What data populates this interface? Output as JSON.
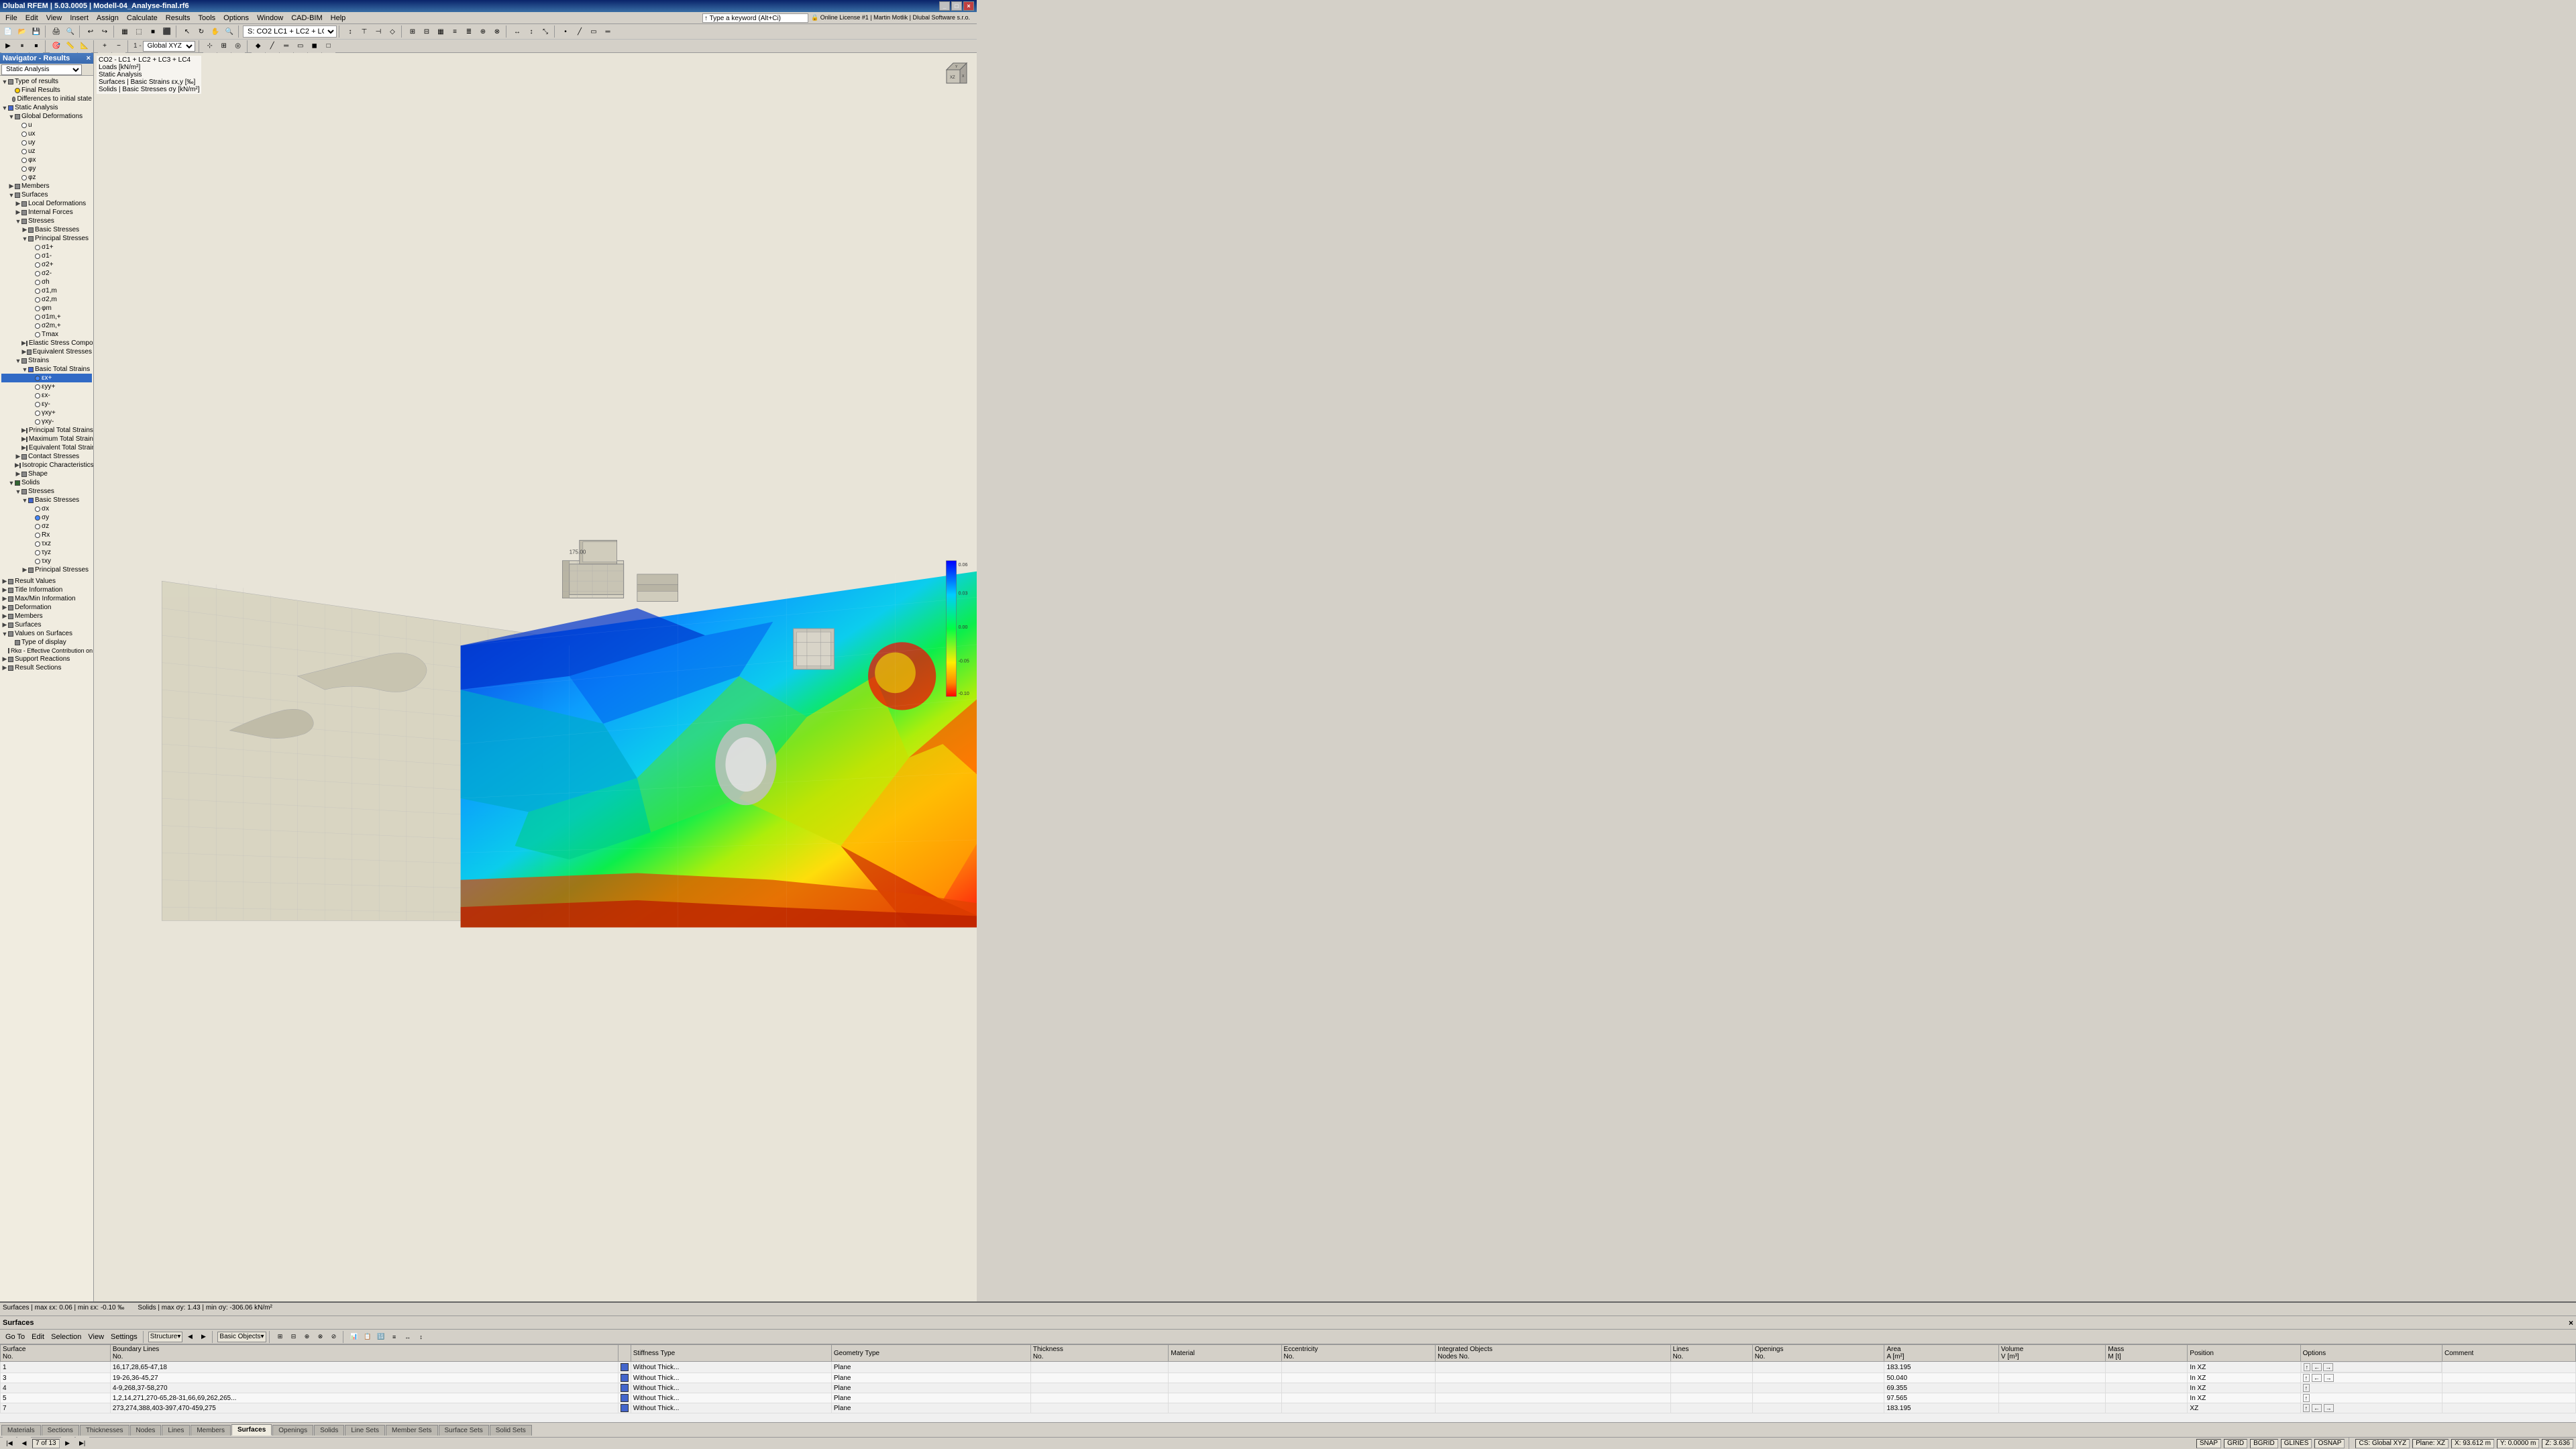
{
  "titleBar": {
    "title": "Dlubal RFEM | 5.03.0005 | Modell-04_Analyse-final.rf6",
    "buttons": [
      "_",
      "□",
      "×"
    ]
  },
  "menuBar": {
    "items": [
      "File",
      "Edit",
      "View",
      "Insert",
      "Assign",
      "Calculate",
      "Results",
      "Tools",
      "Options",
      "Window",
      "CAD-BIM",
      "Help"
    ]
  },
  "viewHeader": {
    "combo1": "CO2 - LC1 + LC2 + LC3 + LC4",
    "label1": "Loads [kN/m²]",
    "label2": "Static Analysis",
    "item1": "Surfaces | Basic Strains εx,y [‰]",
    "item2": "Solids | Basic Stresses σy [kN/m²]"
  },
  "navigator": {
    "title": "Navigator - Results",
    "sections": [
      {
        "label": "Type of results",
        "expanded": true
      },
      {
        "label": "Final Results",
        "indent": 1
      },
      {
        "label": "Differences to initial state",
        "indent": 1
      },
      {
        "label": "Static Analysis",
        "indent": 0
      },
      {
        "label": "Global Deformations",
        "indent": 1,
        "expanded": true
      },
      {
        "label": "u",
        "indent": 2
      },
      {
        "label": "ux",
        "indent": 2
      },
      {
        "label": "uy",
        "indent": 2
      },
      {
        "label": "uz",
        "indent": 2
      },
      {
        "label": "φx",
        "indent": 2
      },
      {
        "label": "φy",
        "indent": 2
      },
      {
        "label": "φz",
        "indent": 2
      },
      {
        "label": "Members",
        "indent": 1
      },
      {
        "label": "Surfaces",
        "indent": 1,
        "expanded": true
      },
      {
        "label": "Local Deformations",
        "indent": 2
      },
      {
        "label": "Internal Forces",
        "indent": 2
      },
      {
        "label": "Stresses",
        "indent": 2,
        "expanded": true
      },
      {
        "label": "Basic Stresses",
        "indent": 3
      },
      {
        "label": "Principal Stresses",
        "indent": 3,
        "expanded": true
      },
      {
        "label": "σ1+",
        "indent": 4
      },
      {
        "label": "σ1-",
        "indent": 4
      },
      {
        "label": "σ2+",
        "indent": 4
      },
      {
        "label": "σ2-",
        "indent": 4
      },
      {
        "label": "σh",
        "indent": 4
      },
      {
        "label": "σ1,m",
        "indent": 4
      },
      {
        "label": "σ2,m",
        "indent": 4
      },
      {
        "label": "φm",
        "indent": 4
      },
      {
        "label": "σ1m,+",
        "indent": 4
      },
      {
        "label": "σ2m,+",
        "indent": 4
      },
      {
        "label": "Tmax",
        "indent": 4
      },
      {
        "label": "Elastic Stress Components",
        "indent": 3
      },
      {
        "label": "Equivalent Stresses",
        "indent": 3
      },
      {
        "label": "Strains",
        "indent": 2,
        "expanded": true
      },
      {
        "label": "Basic Total Strains",
        "indent": 3,
        "expanded": true
      },
      {
        "label": "εx+",
        "indent": 4
      },
      {
        "label": "εyy+",
        "indent": 4
      },
      {
        "label": "εx-",
        "indent": 4
      },
      {
        "label": "εy-",
        "indent": 4
      },
      {
        "label": "γxy+",
        "indent": 4
      },
      {
        "label": "γxy-",
        "indent": 4
      },
      {
        "label": "Principal Total Strains",
        "indent": 3
      },
      {
        "label": "Maximum Total Strains",
        "indent": 3
      },
      {
        "label": "Equivalent Total Strains",
        "indent": 3
      },
      {
        "label": "Contact Stresses",
        "indent": 2
      },
      {
        "label": "Isotropic Characteristics",
        "indent": 2
      },
      {
        "label": "Shape",
        "indent": 2
      },
      {
        "label": "Solids",
        "indent": 1,
        "expanded": true
      },
      {
        "label": "Stresses",
        "indent": 2,
        "expanded": true
      },
      {
        "label": "Basic Stresses",
        "indent": 3,
        "expanded": true
      },
      {
        "label": "σx",
        "indent": 4
      },
      {
        "label": "σy",
        "indent": 4
      },
      {
        "label": "σz",
        "indent": 4
      },
      {
        "label": "Rx",
        "indent": 4
      },
      {
        "label": "τxz",
        "indent": 4
      },
      {
        "label": "τyz",
        "indent": 4
      },
      {
        "label": "τxy",
        "indent": 4
      },
      {
        "label": "Principal Stresses",
        "indent": 3
      },
      {
        "label": "Result Values",
        "indent": 1
      },
      {
        "label": "Title Information",
        "indent": 1
      },
      {
        "label": "Max/Min Information",
        "indent": 1
      },
      {
        "label": "Deformation",
        "indent": 1
      },
      {
        "label": "Members",
        "indent": 1
      },
      {
        "label": "Surfaces",
        "indent": 1
      },
      {
        "label": "Values on Surfaces",
        "indent": 1
      },
      {
        "label": "Type of display",
        "indent": 2
      },
      {
        "label": "Rkα - Effective Contribution on Surfaces...",
        "indent": 2
      },
      {
        "label": "Support Reactions",
        "indent": 1
      },
      {
        "label": "Result Sections",
        "indent": 1
      }
    ]
  },
  "statusLine": {
    "line1": "Surfaces | max εx: 0.06 | min εx: -0.10 ‰",
    "line2": "Solids | max σy: 1.43 | min σy: -306.06 kN/m²"
  },
  "resultsPanel": {
    "title": "Surfaces",
    "toolbar": {
      "goto": "Go To",
      "edit": "Edit",
      "selection": "Selection",
      "view": "View",
      "settings": "Settings"
    },
    "subtoolbar": {
      "structure": "Structure",
      "basicObjects": "Basic Objects"
    },
    "tableHeaders": [
      "Surface No.",
      "Boundary Lines No.",
      "",
      "Stiffness Type",
      "Geometry Type",
      "Thickness No.",
      "Material",
      "Eccentricity No.",
      "Integrated Objects Nodes No.",
      "Lines No.",
      "Openings No.",
      "Area A [m²]",
      "Volume V [m³]",
      "Mass M [t]",
      "Position",
      "Options",
      "Comment"
    ],
    "rows": [
      {
        "no": "1",
        "boundaryLines": "16,17,28,65-47,18",
        "color": "#4466cc",
        "stiffness": "Without Thick...",
        "geometry": "Plane",
        "material": "",
        "area": "183.195",
        "position": "In XZ",
        "options": "↑ ← →"
      },
      {
        "no": "3",
        "boundaryLines": "19-26,36-45,27",
        "color": "#4466cc",
        "stiffness": "Without Thick...",
        "geometry": "Plane",
        "material": "",
        "area": "50.040",
        "position": "In XZ",
        "options": "↑ ← →"
      },
      {
        "no": "4",
        "boundaryLines": "4-9,268,37-58,270",
        "color": "#4466cc",
        "stiffness": "Without Thick...",
        "geometry": "Plane",
        "material": "",
        "area": "69.355",
        "position": "In XZ",
        "options": "↑"
      },
      {
        "no": "5",
        "boundaryLines": "1,2,14,271,270-65,28-31,66,69,262,265...",
        "color": "#4466cc",
        "stiffness": "Without Thick...",
        "geometry": "Plane",
        "material": "",
        "area": "97.565",
        "position": "In XZ",
        "options": "↑"
      },
      {
        "no": "7",
        "boundaryLines": "273,274,388,403-397,470-459,275",
        "color": "#4466cc",
        "stiffness": "Without Thick...",
        "geometry": "Plane",
        "material": "",
        "area": "183.195",
        "position": "XZ",
        "options": "↑ ← →"
      }
    ]
  },
  "bottomTabs": [
    "Materials",
    "Sections",
    "Thicknesses",
    "Nodes",
    "Lines",
    "Members",
    "Surfaces",
    "Openings",
    "Solids",
    "Line Sets",
    "Member Sets",
    "Surface Sets",
    "Solid Sets"
  ],
  "activTab": "Surfaces",
  "statusBar": {
    "pageInfo": "7 of 13",
    "snap": "SNAP",
    "grid": "GRID",
    "bgrid": "BGRID",
    "glines": "GLINES",
    "osnap": "OSNAP",
    "cs": "CS: Global XYZ",
    "plane": "Plane: XZ",
    "x": "X: 93.612 m",
    "y": "Y: 0.0000 m",
    "z": "Z: 3.636"
  },
  "cubeLabel": "Global XYZ",
  "viewportTitle": "1 - Global XYZ"
}
